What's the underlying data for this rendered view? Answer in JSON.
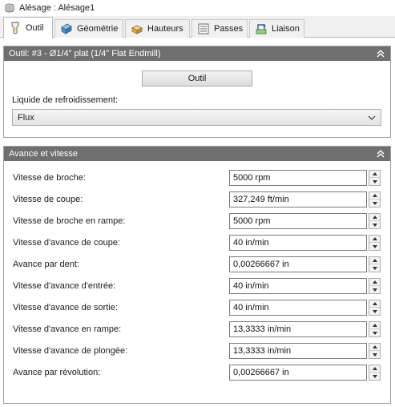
{
  "window": {
    "title": "Alésage : Alésage1"
  },
  "tabs": [
    {
      "label": "Outil",
      "icon": "tool-icon",
      "active": true
    },
    {
      "label": "Géométrie",
      "icon": "geometry-icon",
      "active": false
    },
    {
      "label": "Hauteurs",
      "icon": "heights-icon",
      "active": false
    },
    {
      "label": "Passes",
      "icon": "passes-icon",
      "active": false
    },
    {
      "label": "Liaison",
      "icon": "linking-icon",
      "active": false
    }
  ],
  "tool_panel": {
    "header": "Outil: #3 - Ø1/4\" plat (1/4\" Flat Endmill)",
    "button_label": "Outil",
    "coolant_label": "Liquide de refroidissement:",
    "coolant_value": "Flux"
  },
  "feed_panel": {
    "header": "Avance et vitesse",
    "rows": [
      {
        "label": "Vitesse de broche:",
        "value": "5000 rpm"
      },
      {
        "label": "Vitesse de coupe:",
        "value": "327,249 ft/min"
      },
      {
        "label": "Vitesse de broche en rampe:",
        "value": "5000 rpm"
      },
      {
        "label": "Vitesse d'avance de coupe:",
        "value": "40 in/min"
      },
      {
        "label": "Avance par dent:",
        "value": "0,00266667 in"
      },
      {
        "label": "Vitesse d'avance d'entrée:",
        "value": "40 in/min"
      },
      {
        "label": "Vitesse d'avance de sortie:",
        "value": "40 in/min"
      },
      {
        "label": "Vitesse d'avance en rampe:",
        "value": "13,3333 in/min"
      },
      {
        "label": "Vitesse d'avance de plongée:",
        "value": "13,3333 in/min"
      },
      {
        "label": "Avance par révolution:",
        "value": "0,00266667 in"
      }
    ]
  },
  "colors": {
    "panel_header_bg": "#6f6f6f",
    "tab_strip_bg": "#f0f0f0",
    "tool_icon_accent": "#f0c040"
  }
}
